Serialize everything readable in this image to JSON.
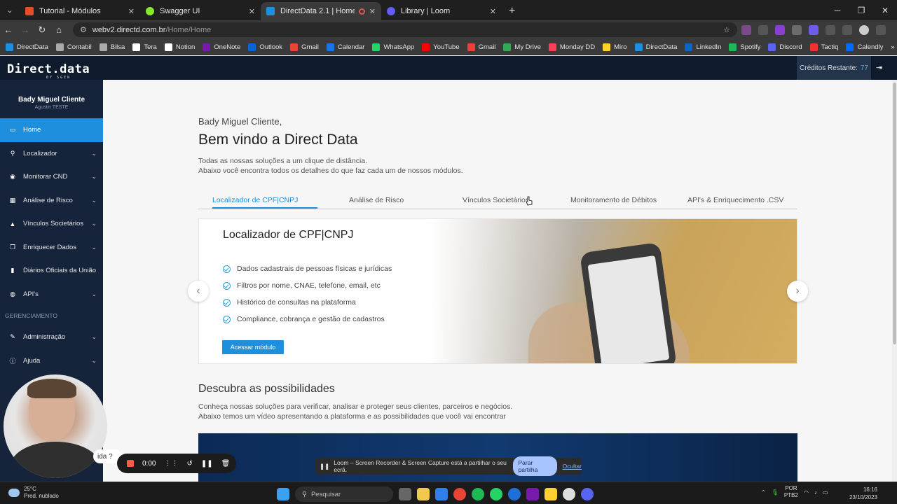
{
  "browser": {
    "tabs": [
      {
        "title": "Tutorial - Módulos",
        "color": "#e44d26",
        "active": false
      },
      {
        "title": "Swagger UI",
        "color": "#85ea2d",
        "active": false
      },
      {
        "title": "DirectData 2.1 | Home",
        "color": "#1e8fdc",
        "active": true
      },
      {
        "title": "Library | Loom",
        "color": "#625df5",
        "active": false
      }
    ],
    "new_tab": "+",
    "url_domain": "webv2.directd.com.br",
    "url_path": "/Home/Home",
    "bookmarks": [
      "DirectData",
      "Contabil",
      "Bilsa",
      "Tera",
      "Notion",
      "OneNote",
      "Outlook",
      "Gmail",
      "Calendar",
      "WhatsApp",
      "YouTube",
      "Gmail",
      "My Drive",
      "Monday DD",
      "Miro",
      "DirectData",
      "LinkedIn",
      "Spotify",
      "Discord",
      "Tactiq",
      "Calendly"
    ]
  },
  "app": {
    "logo": "Direct.data",
    "logo_sub": "BY SGEN",
    "credits_label": "Créditos Restante:",
    "credits_value": "77"
  },
  "sidebar": {
    "user_name": "Bady Miguel Cliente",
    "user_sub": "Agustin TESTE",
    "items": [
      {
        "label": "Home",
        "icon": "monitor-icon",
        "glyph": "▭",
        "active": true,
        "chevron": false
      },
      {
        "label": "Localizador",
        "icon": "search-icon",
        "glyph": "⚲",
        "active": false,
        "chevron": true
      },
      {
        "label": "Monitorar CND",
        "icon": "eye-icon",
        "glyph": "◉",
        "active": false,
        "chevron": true
      },
      {
        "label": "Análise de Risco",
        "icon": "chart-icon",
        "glyph": "▦",
        "active": false,
        "chevron": true
      },
      {
        "label": "Vínculos Societários",
        "icon": "warning-icon",
        "glyph": "▲",
        "active": false,
        "chevron": true
      },
      {
        "label": "Enriquecer Dados",
        "icon": "copy-icon",
        "glyph": "❐",
        "active": false,
        "chevron": true
      },
      {
        "label": "Diários Oficiais da União",
        "icon": "book-icon",
        "glyph": "▮",
        "active": false,
        "chevron": false
      },
      {
        "label": "API's",
        "icon": "globe-icon",
        "glyph": "◍",
        "active": false,
        "chevron": true
      }
    ],
    "section_label": "GERENCIAMENTO",
    "admin_items": [
      {
        "label": "Administração",
        "icon": "pencil-icon",
        "glyph": "✎",
        "chevron": true
      },
      {
        "label": "Ajuda",
        "icon": "info-icon",
        "glyph": "ⓘ",
        "chevron": true
      }
    ]
  },
  "main": {
    "greeting": "Bady Miguel Cliente,",
    "welcome": "Bem vindo a Direct Data",
    "intro_1": "Todas as nossas soluções a um clique de distância.",
    "intro_2": "Abaixo você encontra todos os detalhes do que faz cada um de nossos módulos.",
    "tabs": [
      {
        "label": "Localizador de CPF|CNPJ",
        "active": true
      },
      {
        "label": "Análise de Risco",
        "active": false
      },
      {
        "label": "Vínculos Societários",
        "active": false
      },
      {
        "label": "Monitoramento de Débitos",
        "active": false
      },
      {
        "label": "API's & Enriquecimento .CSV",
        "active": false
      }
    ],
    "card": {
      "title": "Localizador de CPF|CNPJ",
      "bullets": [
        "Dados cadastrais de pessoas físicas e jurídicas",
        "Filtros por nome, CNAE, telefone, email, etc",
        "Histórico de consultas na plataforma",
        "Compliance, cobrança e gestão de cadastros"
      ],
      "button": "Acessar módulo"
    },
    "discover_title": "Descubra as possibilidades",
    "discover_1": "Conheça nossas soluções para verificar, analisar e proteger seus clientes, parceiros e negócios.",
    "discover_2": "Abaixo temos um vídeo apresentando a plataforma e as possibilidades que você vai encontrar"
  },
  "overlays": {
    "help_text": "ida ?",
    "rec_time": "0:00",
    "share_text": "Loom – Screen Recorder & Screen Capture está a partilhar o seu ecrã.",
    "share_stop": "Parar partilha",
    "share_hide": "Ocultar"
  },
  "taskbar": {
    "temp": "25°C",
    "weather": "Pred. nublado",
    "search": "Pesquisar",
    "lang_1": "POR",
    "lang_2": "PTB2",
    "time": "16:16",
    "date": "23/10/2023"
  },
  "colors": {
    "accent": "#1e8fdc",
    "sidebar": "#15243b",
    "header": "#0f1b2d"
  }
}
